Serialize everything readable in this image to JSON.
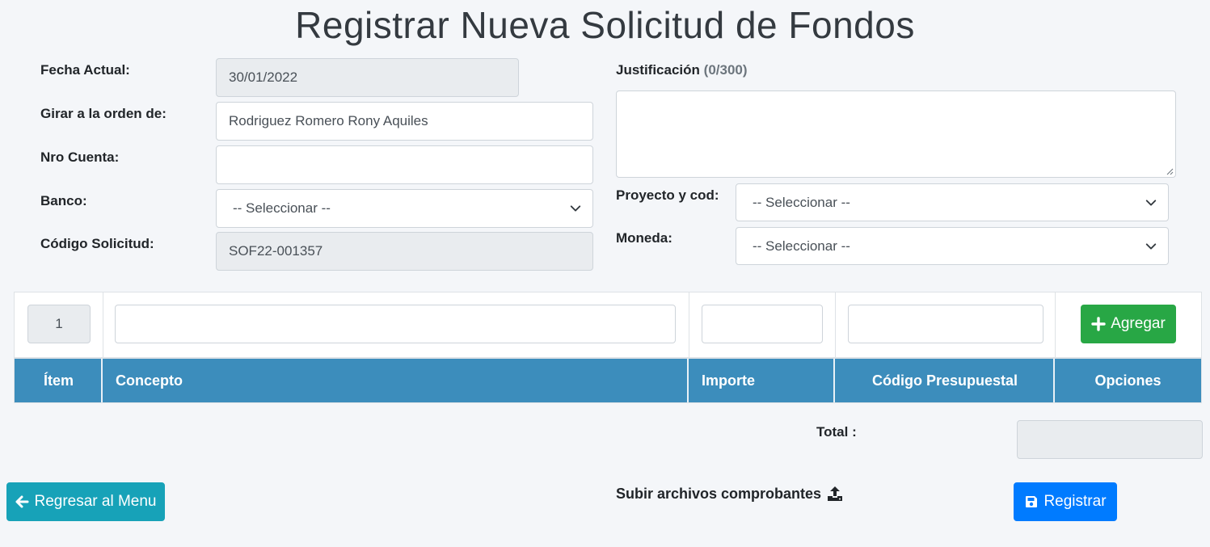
{
  "page": {
    "title": "Registrar Nueva Solicitud de Fondos"
  },
  "form": {
    "fecha_label": "Fecha Actual:",
    "fecha_value": "30/01/2022",
    "girar_label": "Girar a la orden de:",
    "girar_value": "Rodriguez Romero Rony Aquiles",
    "cuenta_label": "Nro Cuenta:",
    "cuenta_value": "",
    "banco_label": "Banco:",
    "banco_selected": "-- Seleccionar --",
    "codigo_label": "Código Solicitud:",
    "codigo_value": "SOF22-001357",
    "justificacion_label": "Justificación",
    "justificacion_count": "(0/300)",
    "justificacion_value": "",
    "proyecto_label": "Proyecto y cod:",
    "proyecto_selected": "-- Seleccionar --",
    "moneda_label": "Moneda:",
    "moneda_selected": "-- Seleccionar --"
  },
  "detail": {
    "item_number": "1",
    "concepto_value": "",
    "importe_value": "",
    "codigo_presupuestal_value": "",
    "add_button_label": "Agregar",
    "columns": [
      "Ítem",
      "Concepto",
      "Importe",
      "Código Presupuestal",
      "Opciones"
    ]
  },
  "totals": {
    "total_label": "Total :",
    "total_value": ""
  },
  "actions": {
    "back_label": "Regresar al Menu",
    "upload_label": "Subir archivos comprobantes",
    "register_label": "Registrar"
  },
  "colors": {
    "header_blue": "#3c8dbc",
    "success": "#28a745",
    "info": "#17a2b8",
    "primary": "#007bff"
  },
  "icons": [
    "chevron-down-icon",
    "plus-icon",
    "arrow-left-icon",
    "upload-icon",
    "save-icon"
  ]
}
